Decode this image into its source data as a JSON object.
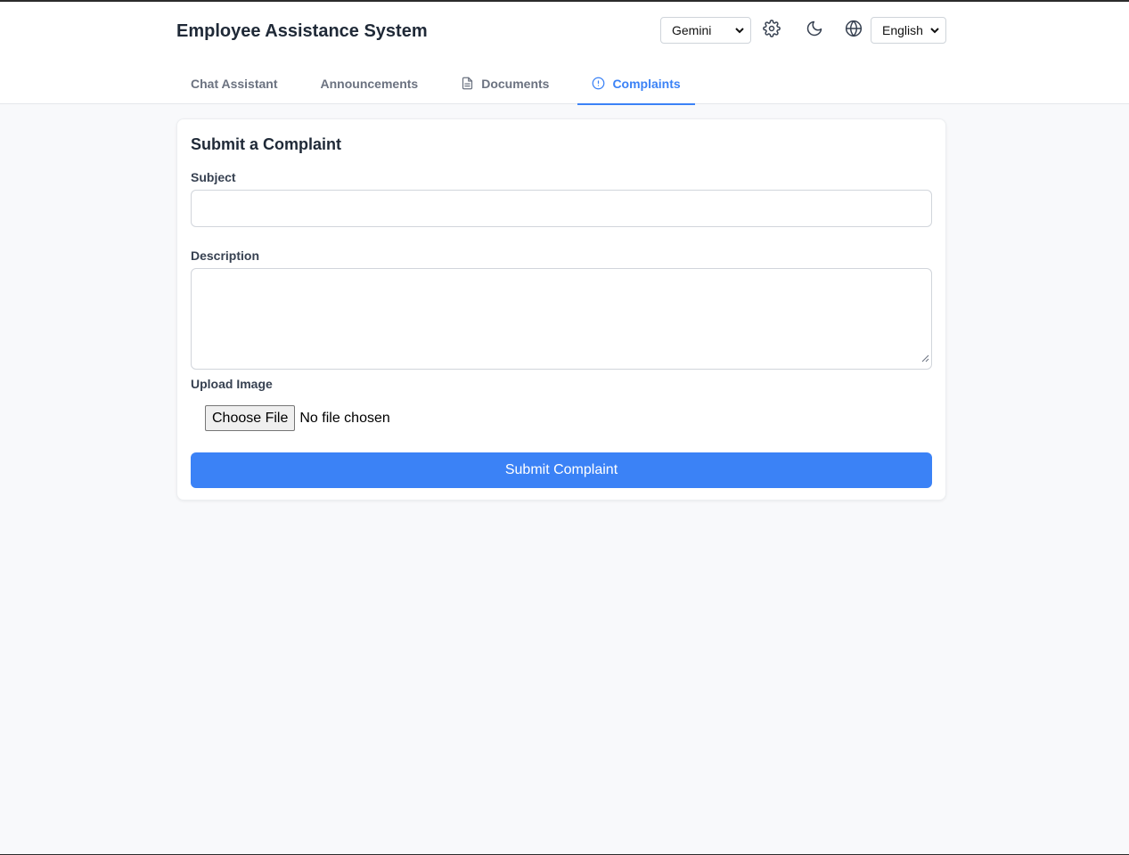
{
  "header": {
    "title": "Employee Assistance System",
    "model_select": {
      "selected": "Gemini"
    },
    "language_select": {
      "selected": "English"
    },
    "icons": [
      "gear-icon",
      "moon-icon",
      "globe-icon"
    ]
  },
  "tabs": [
    {
      "label": "Chat Assistant",
      "icon": null,
      "active": false
    },
    {
      "label": "Announcements",
      "icon": null,
      "active": false
    },
    {
      "label": "Documents",
      "icon": "document-icon",
      "active": false
    },
    {
      "label": "Complaints",
      "icon": "alert-circle-icon",
      "active": true
    }
  ],
  "form": {
    "title": "Submit a Complaint",
    "subject_label": "Subject",
    "subject_value": "",
    "description_label": "Description",
    "description_value": "",
    "upload_label": "Upload Image",
    "file_button": "Choose File",
    "file_status": "No file chosen",
    "submit_label": "Submit Complaint"
  },
  "colors": {
    "accent": "#3b82f6",
    "page_bg": "#f8f9fb",
    "card_bg": "#ffffff",
    "text": "#1f2937",
    "muted_tab": "#6b7280"
  }
}
